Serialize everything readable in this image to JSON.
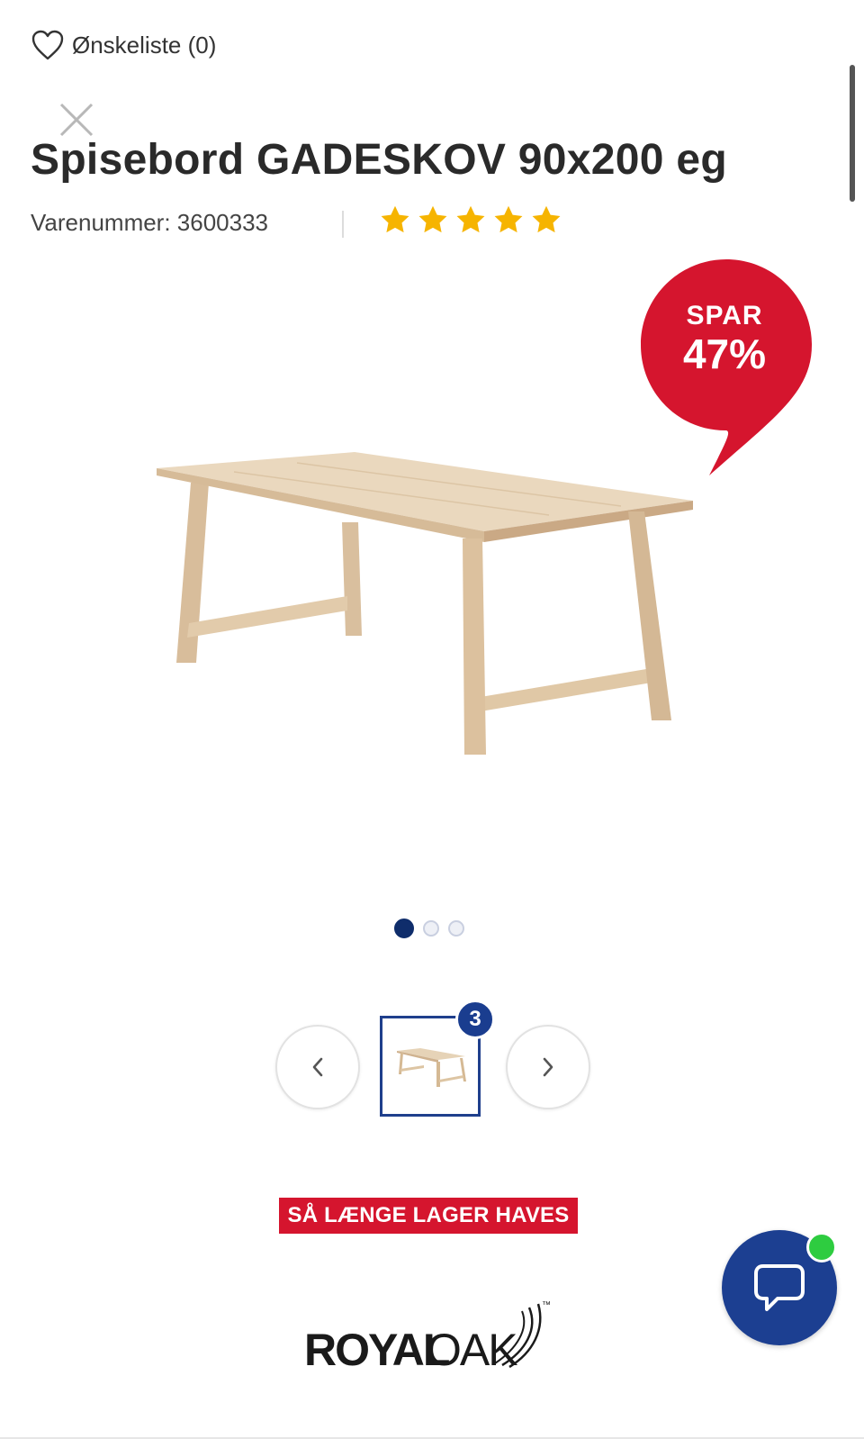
{
  "header": {
    "wishlist_label": "Ønskeliste (0)",
    "wishlist_icon": "heart-icon",
    "close_icon": "close-icon"
  },
  "product": {
    "title": "Spisebord GADESKOV 90x200 eg",
    "sku_text": "Varenummer: 3600333",
    "rating": 5,
    "rating_max": 5,
    "rating_icon": "star-icon"
  },
  "badge": {
    "top": "SPAR",
    "percent": "47%"
  },
  "gallery": {
    "current_image": 1,
    "image_count": 3,
    "thumb_count": "3",
    "prev_icon": "chevron-left-icon",
    "next_icon": "chevron-right-icon"
  },
  "stock_banner": "SÅ LÆNGE LAGER HAVES",
  "brand": {
    "logo_text": "ROYALOAK",
    "trademark": "™"
  },
  "chat": {
    "icon": "chat-bubble-icon",
    "status": "online"
  },
  "colors": {
    "accent_red": "#d5152e",
    "brand_blue": "#1c3f91",
    "star": "#f6b400",
    "online_green": "#2ecc40"
  }
}
